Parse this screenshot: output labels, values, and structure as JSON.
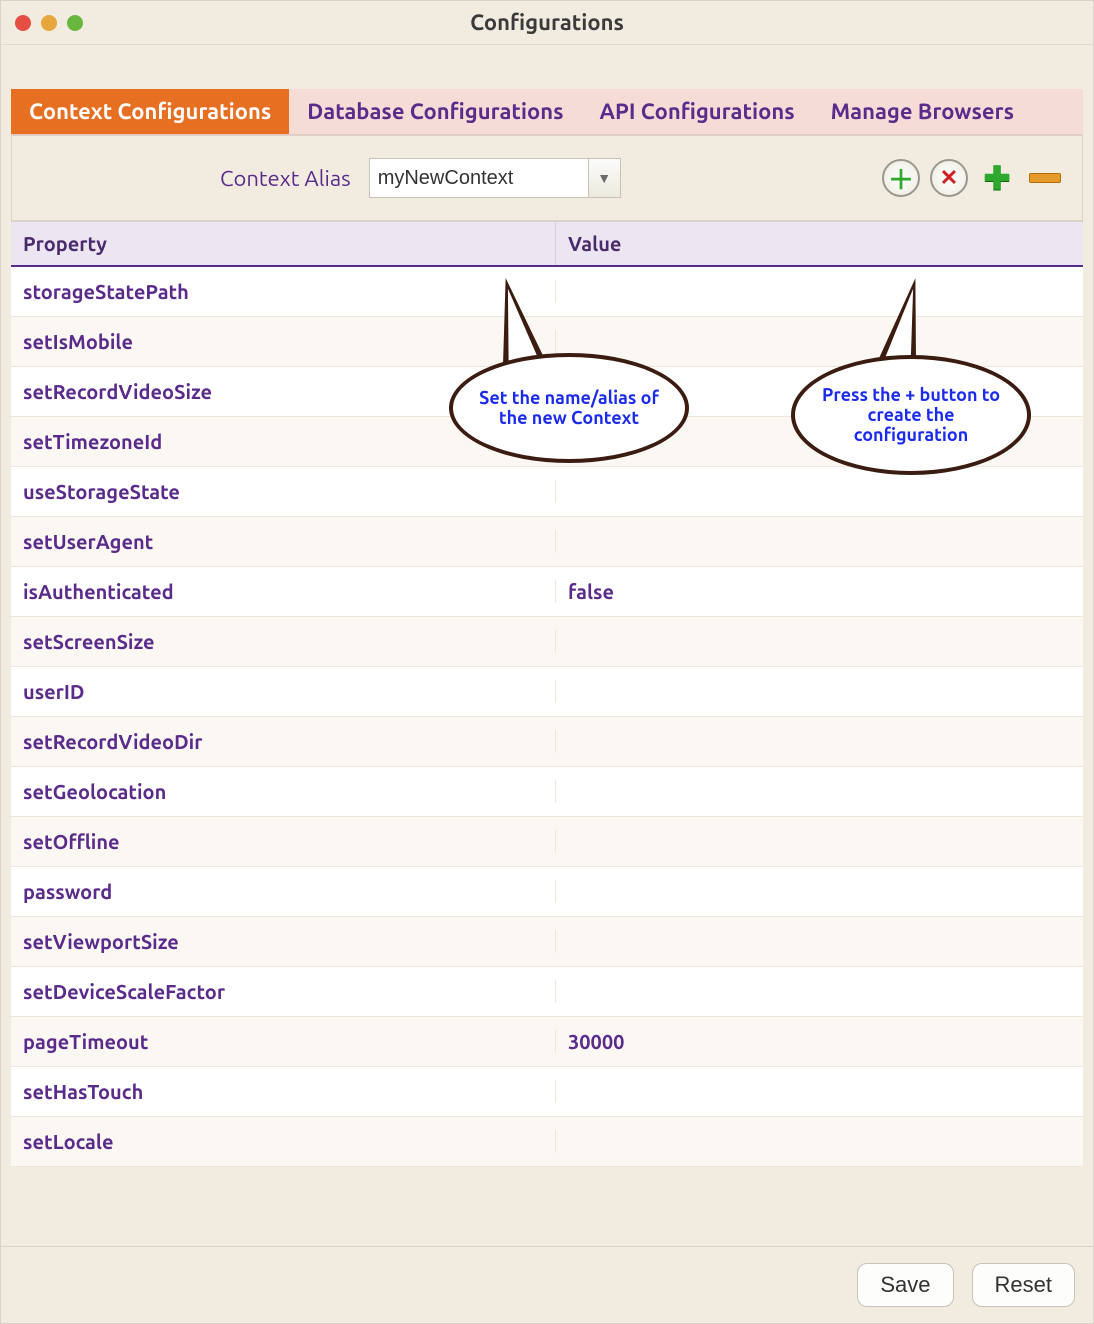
{
  "window": {
    "title": "Configurations"
  },
  "tabs": [
    {
      "label": "Context Configurations",
      "active": true
    },
    {
      "label": "Database Configurations",
      "active": false
    },
    {
      "label": "API Configurations",
      "active": false
    },
    {
      "label": "Manage Browsers",
      "active": false
    }
  ],
  "toolbar": {
    "context_alias_label": "Context Alias",
    "context_alias_value": "myNewContext"
  },
  "table": {
    "headers": {
      "property": "Property",
      "value": "Value"
    },
    "rows": [
      {
        "property": "storageStatePath",
        "value": ""
      },
      {
        "property": "setIsMobile",
        "value": ""
      },
      {
        "property": "setRecordVideoSize",
        "value": ""
      },
      {
        "property": "setTimezoneId",
        "value": ""
      },
      {
        "property": "useStorageState",
        "value": ""
      },
      {
        "property": "setUserAgent",
        "value": ""
      },
      {
        "property": "isAuthenticated",
        "value": "false"
      },
      {
        "property": "setScreenSize",
        "value": ""
      },
      {
        "property": "userID",
        "value": ""
      },
      {
        "property": "setRecordVideoDir",
        "value": ""
      },
      {
        "property": "setGeolocation",
        "value": ""
      },
      {
        "property": "setOffline",
        "value": ""
      },
      {
        "property": "password",
        "value": ""
      },
      {
        "property": "setViewportSize",
        "value": ""
      },
      {
        "property": "setDeviceScaleFactor",
        "value": ""
      },
      {
        "property": "pageTimeout",
        "value": "30000"
      },
      {
        "property": "setHasTouch",
        "value": ""
      },
      {
        "property": "setLocale",
        "value": ""
      }
    ]
  },
  "footer": {
    "save": "Save",
    "reset": "Reset"
  },
  "callouts": {
    "alias": "Set the name/alias of the new Context",
    "plus": "Press the + button to create the configuration"
  }
}
